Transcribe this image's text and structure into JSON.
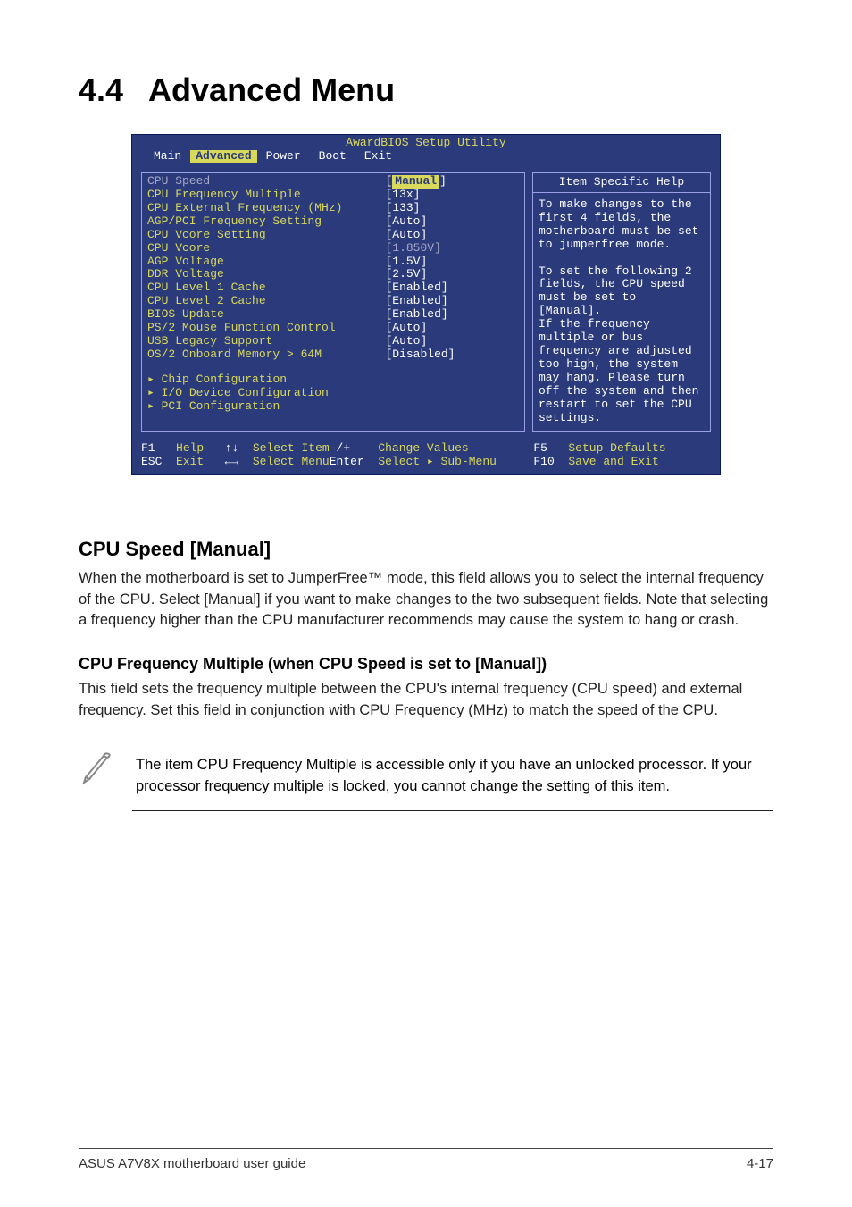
{
  "heading": {
    "number": "4.4",
    "title": "Advanced Menu"
  },
  "bios": {
    "title": "AwardBIOS Setup Utility",
    "tabs": [
      "Main",
      "Advanced",
      "Power",
      "Boot",
      "Exit"
    ],
    "active_tab": "Advanced",
    "rows": [
      {
        "label": "CPU Speed",
        "value": "Manual",
        "lclass": "greytxt",
        "selected": true
      },
      {
        "label": "CPU Frequency Multiple",
        "value": "[13x]",
        "lclass": "yellow"
      },
      {
        "label": "CPU External Frequency (MHz)",
        "value": "[133]",
        "lclass": "yellow"
      },
      {
        "label": "AGP/PCI Frequency Setting",
        "value": "[Auto]",
        "lclass": "yellow"
      },
      {
        "label": "CPU Vcore Setting",
        "value": "[Auto]",
        "lclass": "yellow"
      },
      {
        "label": "CPU Vcore",
        "value": "[1.850V]",
        "lclass": "yellow",
        "vclass": "greytxt"
      },
      {
        "label": "AGP Voltage",
        "value": "[1.5V]",
        "lclass": "yellow"
      },
      {
        "label": "DDR Voltage",
        "value": "[2.5V]",
        "lclass": "yellow"
      },
      {
        "label": "CPU Level 1 Cache",
        "value": "[Enabled]",
        "lclass": "yellow"
      },
      {
        "label": "CPU Level 2 Cache",
        "value": "[Enabled]",
        "lclass": "yellow"
      },
      {
        "label": "BIOS Update",
        "value": "[Enabled]",
        "lclass": "yellow"
      },
      {
        "label": "PS/2 Mouse Function Control",
        "value": "[Auto]",
        "lclass": "yellow"
      },
      {
        "label": "USB Legacy Support",
        "value": "[Auto]",
        "lclass": "yellow"
      },
      {
        "label": "OS/2 Onboard Memory > 64M",
        "value": "[Disabled]",
        "lclass": "yellow"
      }
    ],
    "submenus": [
      "Chip Configuration",
      "I/O Device Configuration",
      "PCI Configuration"
    ],
    "help_title": "Item Specific Help",
    "help_text": "To make changes to the first 4 fields, the motherboard must be set to jumperfree mode.\n\nTo set the following 2 fields, the CPU speed must be set to [Manual].\nIf the frequency multiple or bus frequency are adjusted too high, the system may hang. Please turn off the system and then restart to set the CPU settings.",
    "footer": {
      "l1a": "F1",
      "l1b": "Help",
      "l1c": "↑↓",
      "l1d": "Select Item",
      "l2a": "ESC",
      "l2b": "Exit",
      "l2c": "←→",
      "l2d": "Select Menu",
      "m1a": "-/+",
      "m1b": "Change Values",
      "m2a": "Enter",
      "m2b": "Select ▸ Sub-Menu",
      "r1a": "F5",
      "r1b": "Setup Defaults",
      "r2a": "F10",
      "r2b": "Save and Exit"
    }
  },
  "section": {
    "h3": "CPU Speed [Manual]",
    "p1": "When the motherboard is set to JumperFree™ mode, this field allows you to select the internal frequency of the CPU. Select [Manual] if you want to make changes to the two subsequent fields. Note that selecting a frequency higher than the CPU manufacturer recommends may cause the system to hang or crash.",
    "h4": "CPU Frequency Multiple (when CPU Speed is set to [Manual])",
    "p2": "This field sets the frequency multiple between the CPU's internal frequency (CPU speed) and external frequency. Set this field in conjunction with CPU Frequency (MHz) to match the speed of the CPU.",
    "note": "The item CPU Frequency Multiple is accessible only if you have an unlocked processor. If your processor frequency multiple is locked, you cannot change the setting of this item."
  },
  "pagefoot": {
    "left": "ASUS A7V8X motherboard user guide",
    "right": "4-17"
  }
}
